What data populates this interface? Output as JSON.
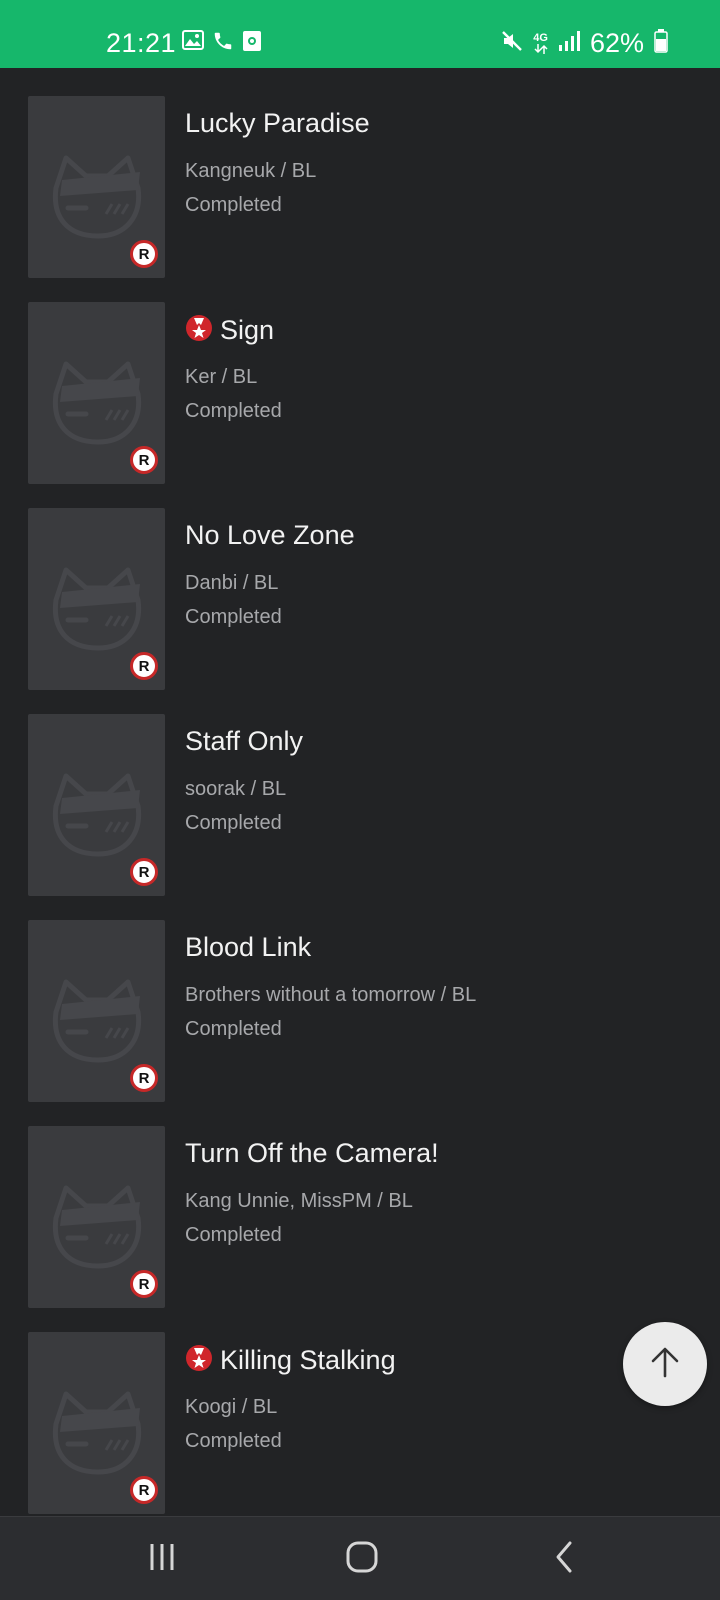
{
  "status_bar": {
    "time": "21:21",
    "battery": "62%",
    "network": "4G",
    "left_icons": [
      "gallery-icon",
      "phone-icon",
      "screen-record-icon"
    ],
    "right_icons": [
      "mute-icon",
      "4g-data-icon",
      "signal-icon",
      "battery-icon"
    ]
  },
  "list": {
    "items": [
      {
        "title": "Lucky Paradise",
        "meta": "Kangneuk / BL",
        "status": "Completed",
        "badge": false,
        "rating": "R"
      },
      {
        "title": "Sign",
        "meta": "Ker / BL",
        "status": "Completed",
        "badge": true,
        "rating": "R"
      },
      {
        "title": "No Love Zone",
        "meta": "Danbi / BL",
        "status": "Completed",
        "badge": false,
        "rating": "R"
      },
      {
        "title": "Staff Only",
        "meta": "soorak / BL",
        "status": "Completed",
        "badge": false,
        "rating": "R"
      },
      {
        "title": "Blood Link",
        "meta": "Brothers without a tomorrow / BL",
        "status": "Completed",
        "badge": false,
        "rating": "R"
      },
      {
        "title": "Turn Off the Camera!",
        "meta": "Kang Unnie, MissPM / BL",
        "status": "Completed",
        "badge": false,
        "rating": "R"
      },
      {
        "title": "Killing Stalking",
        "meta": "Koogi / BL",
        "status": "Completed",
        "badge": true,
        "rating": "R"
      }
    ]
  },
  "fab": {
    "icon": "arrow-up-icon"
  },
  "nav": {
    "icons": [
      "recent-apps-icon",
      "home-icon",
      "back-icon"
    ]
  },
  "colors": {
    "status_bar": "#16b76b",
    "background": "#222325",
    "badge_red": "#c62828"
  }
}
